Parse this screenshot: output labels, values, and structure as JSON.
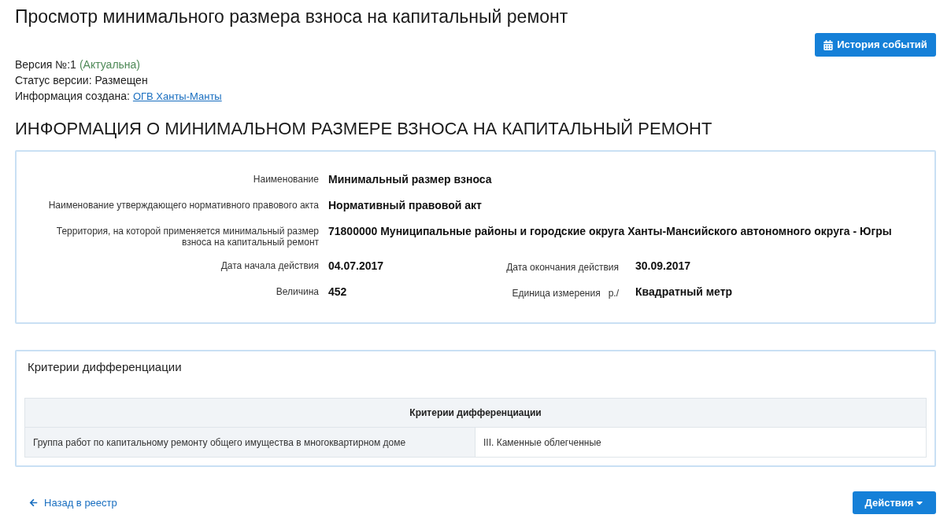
{
  "page_title": "Просмотр минимального размера взноса на капитальный ремонт",
  "history_button": {
    "label": "История событий"
  },
  "version": {
    "label": "Версия №:1",
    "note": "(Актуальна)"
  },
  "version_status": "Статус версии: Размещен",
  "created_by": {
    "label": "Информация создана:",
    "link": "ОГВ Ханты-Манты"
  },
  "section_title": "ИНФОРМАЦИЯ О МИНИМАЛЬНОМ РАЗМЕРЕ ВЗНОСА НА КАПИТАЛЬНЫЙ РЕМОНТ",
  "info_rows": [
    {
      "fields": [
        {
          "label": "Наименование",
          "value": "Минимальный размер взноса"
        }
      ]
    },
    {
      "fields": [
        {
          "label": "Наименование утверждающего нормативного правового акта",
          "value": "Нормативный правовой акт"
        }
      ]
    },
    {
      "fields": [
        {
          "label": "Территория, на которой применяется минимальный размер взноса на капитальный ремонт",
          "value": "71800000 Муниципальные районы и городские округа Ханты-Мансийского автономного округа - Югры"
        }
      ]
    },
    {
      "fields": [
        {
          "label": "Дата начала действия",
          "value": "04.07.2017"
        },
        {
          "label": "Дата окончания действия",
          "value": "30.09.2017"
        }
      ]
    },
    {
      "fields": [
        {
          "label": "Величина",
          "value": "452"
        },
        {
          "label": "Единица измерения",
          "unit": "р./",
          "value": "Квадратный метр"
        }
      ]
    }
  ],
  "criteria_panel": {
    "title": "Критерии дифференциации",
    "table": {
      "header": "Критерии дифференциации",
      "rows": [
        {
          "cells": [
            "Группа работ по капитальному ремонту общего имущества в многоквартирном доме",
            "III. Каменные облегченные"
          ]
        }
      ]
    }
  },
  "back_link": "Назад в реестр",
  "actions_button": "Действия"
}
